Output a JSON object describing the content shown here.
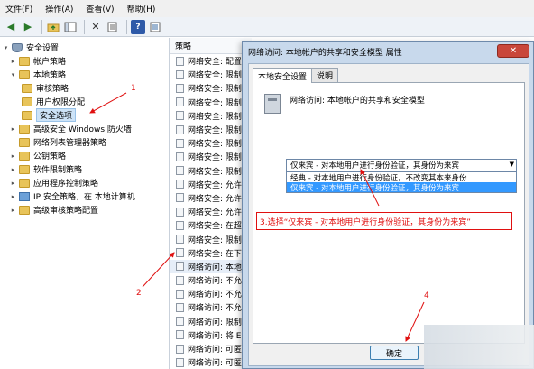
{
  "menubar": {
    "items": [
      "文件(F)",
      "操作(A)",
      "查看(V)",
      "帮助(H)"
    ]
  },
  "toolbar": {
    "buttons": [
      "back-icon",
      "forward-icon",
      "up-folder-icon",
      "show-hide-tree-icon",
      "delete-icon",
      "export-icon",
      "help-icon",
      "properties-icon"
    ]
  },
  "tree": {
    "items": [
      {
        "label": "安全设置",
        "icon": "shield-icon",
        "level": 0,
        "expander": "▾"
      },
      {
        "label": "帐户策略",
        "icon": "folder-icon",
        "level": 1,
        "expander": "▸"
      },
      {
        "label": "本地策略",
        "icon": "folder-icon",
        "level": 1,
        "expander": "▾"
      },
      {
        "label": "审核策略",
        "icon": "folder-icon",
        "level": 2,
        "expander": ""
      },
      {
        "label": "用户权限分配",
        "icon": "folder-icon",
        "level": 2,
        "expander": ""
      },
      {
        "label": "安全选项",
        "icon": "folder-icon",
        "level": 2,
        "expander": "",
        "selected": true
      },
      {
        "label": "高级安全 Windows 防火墙",
        "icon": "folder-icon",
        "level": 1,
        "expander": "▸"
      },
      {
        "label": "网络列表管理器策略",
        "icon": "folder-icon",
        "level": 1,
        "expander": ""
      },
      {
        "label": "公钥策略",
        "icon": "folder-icon",
        "level": 1,
        "expander": "▸"
      },
      {
        "label": "软件限制策略",
        "icon": "folder-icon",
        "level": 1,
        "expander": "▸"
      },
      {
        "label": "应用程序控制策略",
        "icon": "folder-icon",
        "level": 1,
        "expander": "▸"
      },
      {
        "label": "IP 安全策略，在 本地计算机",
        "icon": "computer-icon",
        "level": 1,
        "expander": "▸"
      },
      {
        "label": "高级审核策略配置",
        "icon": "folder-icon",
        "level": 1,
        "expander": "▸"
      }
    ]
  },
  "list": {
    "header": "策略",
    "rows": [
      "网络安全: 配置",
      "网络安全: 限制",
      "网络安全: 限制",
      "网络安全: 限制",
      "网络安全: 限制",
      "网络安全: 限制",
      "网络安全: 限制",
      "网络安全: 限制",
      "网络安全: 限制",
      "网络安全: 允许",
      "网络安全: 允许",
      "网络安全: 允许",
      "网络安全: 在超",
      "网络安全: 限制",
      "网络安全: 在下",
      "网络访问: 本地帐",
      "网络访问: 不允",
      "网络访问: 不允",
      "网络访问: 不允",
      "网络访问: 限制",
      "网络访问: 将 E",
      "网络访问: 可匿",
      "网络访问: 可匿",
      "网络访问: 可远"
    ],
    "highlighted_index": 15
  },
  "dialog": {
    "title": "网络访问: 本地帐户的共享和安全模型 属性",
    "close_symbol": "✕",
    "tabs": [
      {
        "label": "本地安全设置",
        "active": true
      },
      {
        "label": "说明",
        "active": false
      }
    ],
    "policy_name": "网络访问: 本地帐户的共享和安全模型",
    "select_value": "仅来宾 - 对本地用户进行身份验证，其身份为来宾",
    "options": [
      "经典 - 对本地用户进行身份验证，不改变其本来身份",
      "仅来宾 - 对本地用户进行身份验证，其身份为来宾"
    ],
    "selected_option_index": 1,
    "ok_label": "确定"
  },
  "annotations": {
    "step1": "1",
    "step2": "2",
    "step3": "3.选择“仅来宾 - 对本地用户进行身份验证，其身份为来宾”",
    "step4": "4",
    "color": "#e01010"
  }
}
